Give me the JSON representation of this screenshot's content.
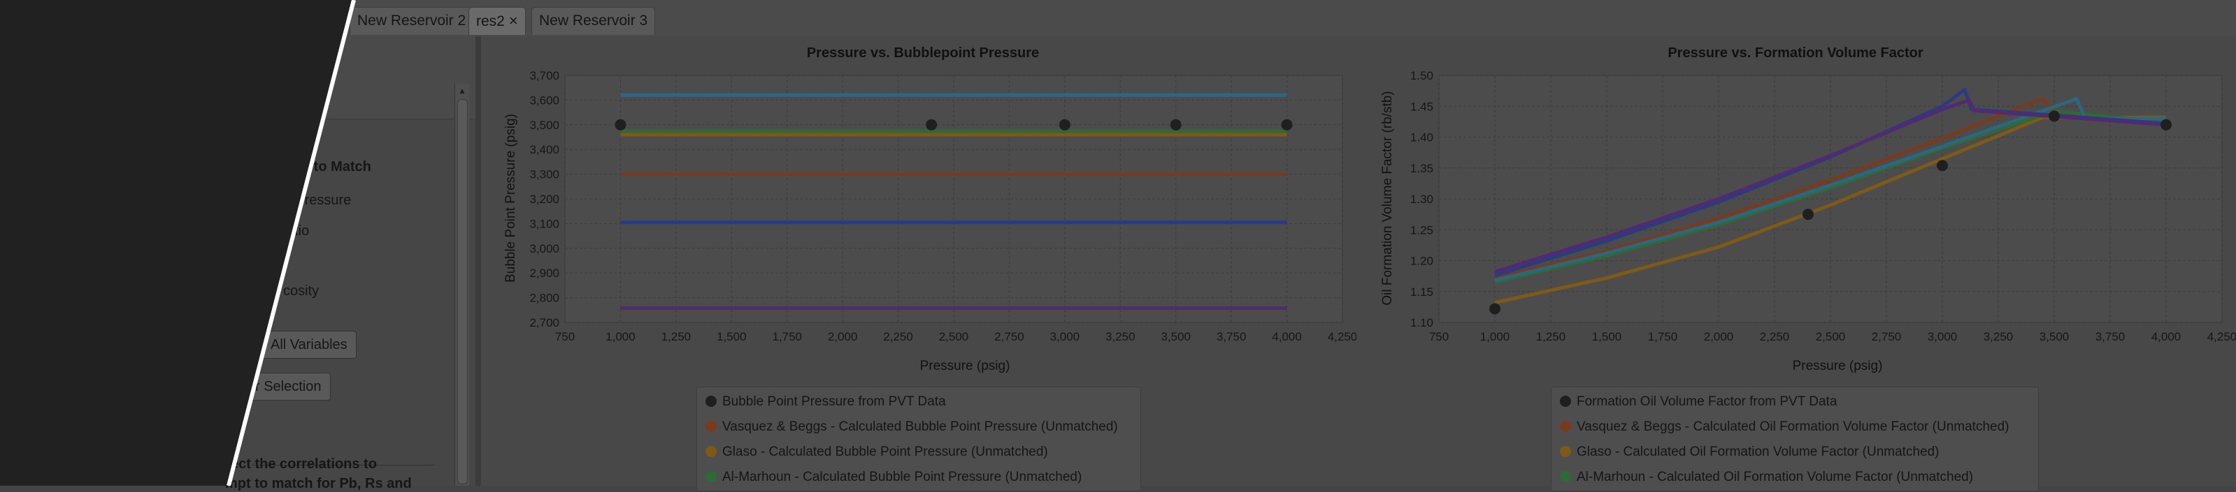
{
  "tabs": [
    {
      "label": "New Reservoir 2",
      "active": false,
      "closable": false
    },
    {
      "label": "res2",
      "active": true,
      "closable": true
    },
    {
      "label": "New Reservoir 3",
      "active": false,
      "closable": false
    }
  ],
  "close_glyph": "×",
  "left_panel": {
    "heading_fragment": "e to Match",
    "checkbox_labels": [
      "nt Pressure",
      "atio",
      "cosity"
    ],
    "buttons": [
      "All Variables",
      "r Selection"
    ],
    "instruction_line1": "ect the correlations to",
    "instruction_line2": "mpt to match for Pb, Rs and",
    "scroll_up_icon": "up-arrow-icon"
  },
  "chart1": {
    "chart_data": {
      "type": "line",
      "title": "Pressure vs. Bubblepoint Pressure",
      "xlabel": "Pressure (psig)",
      "ylabel": "Bubble Point Pressure (psig)",
      "xlim": [
        750,
        4250
      ],
      "ylim": [
        2700,
        3700
      ],
      "x_ticks": [
        "750",
        "1,000",
        "1,250",
        "1,500",
        "1,750",
        "2,000",
        "2,250",
        "2,500",
        "2,750",
        "3,000",
        "3,250",
        "3,500",
        "3,750",
        "4,000",
        "4,250"
      ],
      "y_ticks": [
        "2,700",
        "2,800",
        "2,900",
        "3,000",
        "3,100",
        "3,200",
        "3,300",
        "3,400",
        "3,500",
        "3,600",
        "3,700"
      ],
      "grid": true,
      "legend_position": "bottom",
      "series": [
        {
          "name": "Bubble Point Pressure from PVT Data",
          "kind": "scatter",
          "color": "#1f1f1f",
          "x": [
            1000,
            2400,
            3000,
            3500,
            4000
          ],
          "y": [
            3500,
            3500,
            3500,
            3500,
            3500
          ]
        },
        {
          "name": "Vasquez & Beggs - Calculated Bubble Point Pressure (Unmatched)",
          "kind": "line",
          "color": "#7a3a1e",
          "x": [
            1000,
            4000
          ],
          "y": [
            3300,
            3300
          ]
        },
        {
          "name": "Glaso - Calculated Bubble Point Pressure (Unmatched)",
          "kind": "line",
          "color": "#7d5a17",
          "x": [
            1000,
            4000
          ],
          "y": [
            3460,
            3460
          ]
        },
        {
          "name": "Al-Marhoun - Calculated Bubble Point Pressure (Unmatched)",
          "kind": "line",
          "color": "#2d6a36",
          "x": [
            1000,
            4000
          ],
          "y": [
            3475,
            3475
          ]
        },
        {
          "name": "",
          "kind": "line",
          "color": "#2e6680",
          "x": [
            1000,
            4000
          ],
          "y": [
            3620,
            3620
          ]
        },
        {
          "name": "",
          "kind": "line",
          "color": "#283c7e",
          "x": [
            1000,
            4000
          ],
          "y": [
            3105,
            3105
          ]
        },
        {
          "name": "",
          "kind": "line",
          "color": "#522a72",
          "x": [
            1000,
            4000
          ],
          "y": [
            2758,
            2758
          ]
        }
      ]
    }
  },
  "chart2": {
    "chart_data": {
      "type": "line",
      "title": "Pressure vs. Formation Volume Factor",
      "xlabel": "Pressure (psig)",
      "ylabel": "Oil Formation Volume Factor (rb/stb)",
      "xlim": [
        750,
        4250
      ],
      "ylim": [
        1.1,
        1.5
      ],
      "x_ticks": [
        "750",
        "1,000",
        "1,250",
        "1,500",
        "1,750",
        "2,000",
        "2,250",
        "2,500",
        "2,750",
        "3,000",
        "3,250",
        "3,500",
        "3,750",
        "4,000",
        "4,250"
      ],
      "y_ticks": [
        "1.10",
        "1.15",
        "1.20",
        "1.25",
        "1.30",
        "1.35",
        "1.40",
        "1.45",
        "1.50"
      ],
      "grid": true,
      "legend_position": "bottom",
      "series": [
        {
          "name": "Formation Oil Volume Factor from PVT Data",
          "kind": "scatter",
          "color": "#1f1f1f",
          "x": [
            1000,
            2400,
            3000,
            3500,
            4000
          ],
          "y": [
            1.122,
            1.275,
            1.354,
            1.434,
            1.42
          ]
        },
        {
          "name": "Vasquez & Beggs - Calculated Oil Formation Volume Factor (Unmatched)",
          "kind": "line",
          "color": "#7a3a1e",
          "x": [
            1000,
            1500,
            2000,
            2500,
            3000,
            3450,
            3500,
            4000
          ],
          "y": [
            1.172,
            1.215,
            1.268,
            1.33,
            1.398,
            1.462,
            1.44,
            1.425
          ]
        },
        {
          "name": "Glaso - Calculated Oil Formation Volume Factor (Unmatched)",
          "kind": "line",
          "color": "#7d5a17",
          "x": [
            1000,
            1500,
            2000,
            2500,
            3000,
            3450,
            4000
          ],
          "y": [
            1.132,
            1.172,
            1.222,
            1.29,
            1.365,
            1.432,
            1.432
          ]
        },
        {
          "name": "Al-Marhoun - Calculated Oil Formation Volume Factor (Unmatched)",
          "kind": "line",
          "color": "#2d6a36",
          "x": [
            1000,
            1500,
            2000,
            2500,
            3000,
            3500,
            4000
          ],
          "y": [
            1.165,
            1.208,
            1.258,
            1.318,
            1.382,
            1.442,
            1.424
          ]
        },
        {
          "name": "",
          "kind": "line",
          "color": "#2e6680",
          "x": [
            1000,
            1500,
            2000,
            2500,
            3000,
            3600,
            3640,
            4000
          ],
          "y": [
            1.168,
            1.212,
            1.262,
            1.322,
            1.385,
            1.462,
            1.43,
            1.43
          ]
        },
        {
          "name": "",
          "kind": "line",
          "color": "#283c7e",
          "x": [
            1000,
            1500,
            2000,
            2500,
            3000,
            3100,
            3130,
            4000
          ],
          "y": [
            1.176,
            1.232,
            1.295,
            1.368,
            1.45,
            1.477,
            1.445,
            1.422
          ]
        },
        {
          "name": "",
          "kind": "line",
          "color": "#522a72",
          "x": [
            1000,
            1500,
            2000,
            2500,
            3000,
            3120,
            3140,
            4000
          ],
          "y": [
            1.182,
            1.238,
            1.3,
            1.37,
            1.445,
            1.46,
            1.443,
            1.42
          ]
        }
      ]
    }
  }
}
